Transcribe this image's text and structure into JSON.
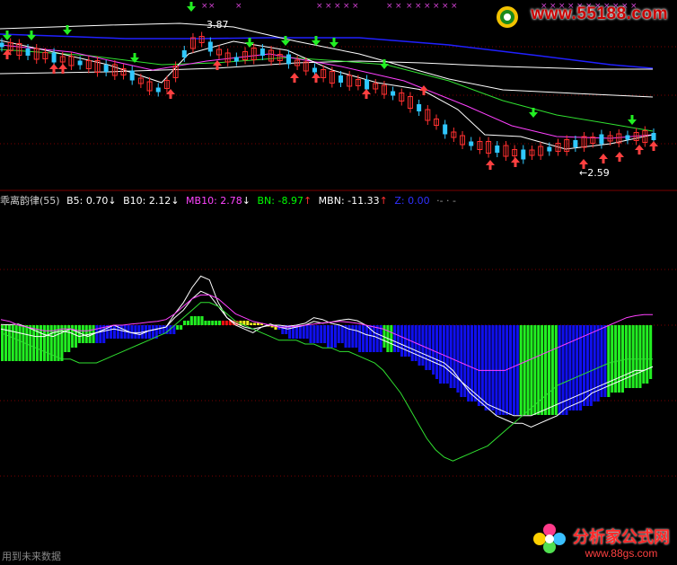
{
  "price_panel": {
    "high_label": "3.87",
    "low_label": "←2.59"
  },
  "indicator": {
    "name": "乖离韵律(55)",
    "b5": {
      "label": "B5: ",
      "value": "0.70",
      "arrow": "↓"
    },
    "b10": {
      "label": "B10: ",
      "value": "2.12",
      "arrow": "↓"
    },
    "mb10": {
      "label": "MB10: ",
      "value": "2.78",
      "arrow": "↓"
    },
    "bn": {
      "label": "BN: ",
      "value": "-8.97",
      "arrow": "↑"
    },
    "mbn": {
      "label": "MBN: ",
      "value": "-11.33",
      "arrow": "↑"
    },
    "z": {
      "label": "Z: ",
      "value": "0.00"
    },
    "trailing": "·- · -"
  },
  "footer_note": "用到未来数据",
  "watermarks": {
    "top_url": "www.55188.com",
    "bottom_title": "分析家公式网",
    "bottom_url": "www.88gs.com"
  },
  "colors": {
    "background": "#000000",
    "bar_green": "#22ee22",
    "bar_blue": "#1010ee",
    "bar_red": "#ee1010",
    "bar_yellow": "#eeee20",
    "candle_up": "#ff3030",
    "candle_down": "#30c8ff",
    "ma_white": "#ffffff",
    "ma_blue": "#2020ff",
    "ma_green": "#30e030",
    "ma_magenta": "#ff40ff",
    "grid_red": "#7a0000"
  },
  "chart_data": {
    "type": "bar",
    "title": "乖离韵律(55)",
    "bar_values": [
      -8,
      -8,
      -8,
      -8,
      -8,
      -8,
      -8,
      -8,
      -8,
      -8,
      -8,
      -8,
      -8,
      -8,
      -8,
      -8,
      -8,
      -8,
      -6,
      -6,
      -5,
      -5,
      -4,
      -4,
      -4,
      -4,
      -4,
      -4,
      -4,
      -4,
      -3,
      -3,
      -3,
      -3,
      -3,
      -3,
      -3,
      -3,
      -3,
      -3,
      -3,
      -3,
      -3,
      -3,
      -3,
      -2,
      -2,
      -2,
      -2,
      -2,
      -1,
      -1,
      1,
      1,
      2,
      2,
      2,
      2,
      1,
      1,
      1,
      1,
      1,
      1,
      1,
      1,
      1,
      1,
      1,
      1,
      1,
      0.5,
      0.5,
      0.5,
      0.5,
      0,
      -0.3,
      -0.5,
      -1,
      -1,
      -2,
      -2,
      -3,
      -3,
      -3,
      -3,
      -3,
      -3,
      -4,
      -4,
      -4,
      -4,
      -4,
      -5,
      -5,
      -5,
      -4,
      -4,
      -5,
      -5,
      -5,
      -5,
      -6,
      -6,
      -6,
      -6,
      -6,
      -6,
      -6,
      -5,
      -6,
      -6,
      -6,
      -6,
      -7,
      -7,
      -7,
      -8,
      -8,
      -9,
      -9,
      -10,
      -10,
      -11,
      -12,
      -13,
      -13,
      -13,
      -14,
      -14,
      -15,
      -16,
      -16,
      -17,
      -17,
      -17,
      -18,
      -18,
      -19,
      -19,
      -19,
      -20,
      -20,
      -20,
      -20,
      -20,
      -20,
      -20,
      -20,
      -20,
      -20,
      -20,
      -20,
      -20,
      -20,
      -20,
      -20,
      -20,
      -20,
      -20,
      -20,
      -20,
      -19,
      -19,
      -19,
      -19,
      -18,
      -18,
      -18,
      -17,
      -17,
      -16,
      -16,
      -16,
      -15,
      -15,
      -15,
      -15,
      -14,
      -14,
      -14,
      -14,
      -14,
      -13,
      -13,
      -12
    ],
    "bar_colors": "GGGGGGGGGGGGGGGGGGGGGGGGGGGBBBBBBBBBBBBBBBBBBBBBBBGGGGGGGGGGGGGRRRRRYYYYYYYYYYYBBBBBBBBBBBBBBBBBBBBBBBBBBBBBBGGGBBBBBBBBBBBBBBBBBBBBBBBBBBBBBBBBBBBBGGGGGGGGGGGBBBBBBBBBBBBBBGGGGGGGGGGGGGGGGGG",
    "series": [
      {
        "name": "B5",
        "values": [
          0.2,
          0.1,
          0.3,
          -0.5,
          -1.5,
          -2.5,
          -3,
          -2,
          -1,
          -2,
          -3,
          -2,
          -1,
          0,
          -1,
          -2,
          -2.5,
          -1.5,
          -1,
          -0.5,
          3,
          6,
          10,
          13,
          12,
          6,
          2,
          0,
          -1,
          -2,
          -0.5,
          0.3,
          -0.5,
          -1,
          -0.5,
          0,
          1,
          0.5,
          0.8,
          1.3,
          1.6,
          1.2,
          0,
          -2,
          -3,
          -4,
          -5,
          -6,
          -7,
          -8,
          -9,
          -10,
          -12,
          -15,
          -18,
          -20,
          -22,
          -24,
          -25,
          -26,
          -26,
          -27,
          -26,
          -25,
          -24,
          -22,
          -21,
          -20,
          -18,
          -17,
          -16,
          -15,
          -14,
          -13,
          -12,
          -11
        ]
      },
      {
        "name": "B10",
        "values": [
          -1,
          -1.5,
          -2,
          -2.5,
          -3,
          -3,
          -2,
          -1.5,
          -2,
          -3,
          -2.5,
          -2,
          -1.5,
          -1,
          -1.5,
          -2,
          -2,
          -1.5,
          -1,
          -0.5,
          2,
          4,
          7,
          9,
          8,
          5,
          2,
          0.5,
          -0.5,
          -1,
          -0.5,
          0,
          0,
          -0.3,
          0,
          0.5,
          2,
          1.5,
          0.5,
          0,
          -1,
          -1.5,
          -2.5,
          -3,
          -4,
          -5,
          -6,
          -7,
          -8,
          -9,
          -10,
          -11,
          -13,
          -15,
          -17,
          -19,
          -21,
          -22,
          -23,
          -24,
          -24,
          -24,
          -23,
          -22,
          -21,
          -20,
          -19,
          -18,
          -17,
          -16,
          -15,
          -14,
          -13,
          -12,
          -12,
          -11
        ]
      },
      {
        "name": "MB10",
        "values": [
          1.5,
          1,
          0,
          -0.5,
          -1,
          -1.5,
          -1.5,
          -1,
          -1,
          -1.5,
          -1.5,
          -1,
          -0.5,
          0,
          0,
          0.3,
          0.5,
          0.8,
          1,
          1.5,
          3,
          5,
          7,
          8,
          8,
          7,
          5,
          3,
          2,
          1,
          0.5,
          0,
          -0.5,
          -0.5,
          -0.3,
          0,
          0.3,
          0.6,
          0.8,
          1,
          0.8,
          0.5,
          0,
          -0.5,
          -1,
          -2,
          -3,
          -4,
          -5,
          -6,
          -7,
          -8,
          -9,
          -10,
          -11,
          -12,
          -12,
          -12,
          -12,
          -11,
          -10,
          -9,
          -8,
          -7,
          -6,
          -5,
          -4,
          -3,
          -2,
          -1,
          0,
          1,
          2,
          2.5,
          2.8,
          2.78
        ]
      },
      {
        "name": "BN",
        "values": [
          -2,
          -3,
          -4,
          -5,
          -6,
          -7,
          -8,
          -9,
          -9,
          -10,
          -10,
          -10,
          -9,
          -8,
          -7,
          -6,
          -5,
          -4,
          -3,
          -2,
          0,
          2,
          4,
          6,
          6,
          5,
          3,
          1,
          0,
          -1,
          -2,
          -3,
          -4,
          -4,
          -4,
          -5,
          -5,
          -6,
          -6,
          -7,
          -7,
          -8,
          -9,
          -10,
          -12,
          -15,
          -18,
          -22,
          -26,
          -30,
          -33,
          -35,
          -36,
          -35,
          -34,
          -33,
          -32,
          -30,
          -28,
          -26,
          -24,
          -22,
          -20,
          -18,
          -16,
          -15,
          -14,
          -13,
          -12,
          -11,
          -10,
          -9.5,
          -9,
          -9,
          -9,
          -8.97
        ]
      }
    ]
  }
}
